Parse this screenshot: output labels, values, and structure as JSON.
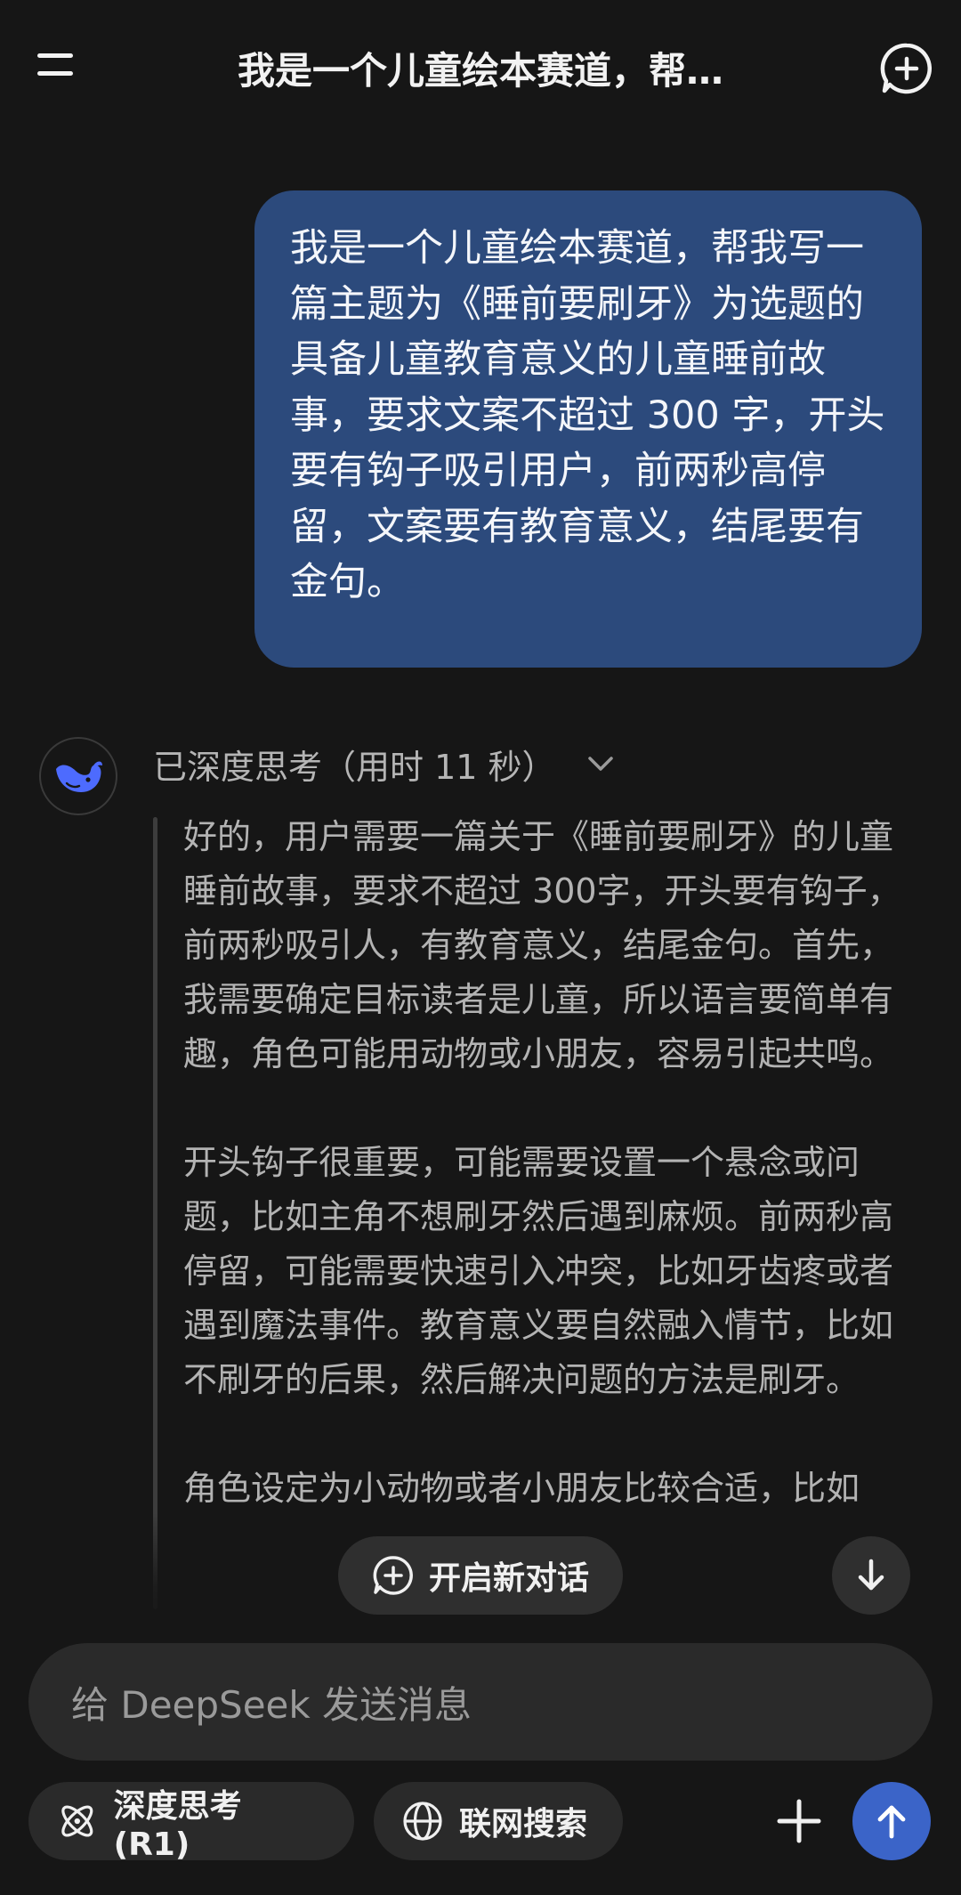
{
  "header": {
    "title": "我是一个儿童绘本赛道，帮…",
    "menu_icon": "menu-icon",
    "new_chat_icon": "new-chat-icon"
  },
  "user_message": "我是一个儿童绘本赛道，帮我写一篇主题为《睡前要刷牙》为选题的具备儿童教育意义的儿童睡前故事，要求文案不超过 300 字，开头要有钩子吸引用户，前两秒高停留，文案要有教育意义，结尾要有金句。",
  "assistant": {
    "think_label": "已深度思考（用时 11 秒）",
    "paragraphs": [
      "好的，用户需要一篇关于《睡前要刷牙》的儿童睡前故事，要求不超过 300字，开头要有钩子，前两秒吸引人，有教育意义，结尾金句。首先，我需要确定目标读者是儿童，所以语言要简单有趣，角色可能用动物或小朋友，容易引起共鸣。",
      "开头钩子很重要，可能需要设置一个悬念或问题，比如主角不想刷牙然后遇到麻烦。前两秒高停留，可能需要快速引入冲突，比如牙齿疼或者遇到魔法事件。教育意义要自然融入情节，比如不刷牙的后果，然后解决问题的方法是刷牙。",
      "角色设定为小动物或者小朋友比较合适，比如"
    ]
  },
  "floating": {
    "new_chat_label": "开启新对话"
  },
  "input": {
    "placeholder": "给 DeepSeek 发送消息"
  },
  "toolbar": {
    "deep_think_label": "深度思考 (R1)",
    "web_search_label": "联网搜索"
  },
  "colors": {
    "background": "#161616",
    "user_bubble": "#2c4a7c",
    "accent": "#3b64c8",
    "whale": "#4d6bfe"
  }
}
